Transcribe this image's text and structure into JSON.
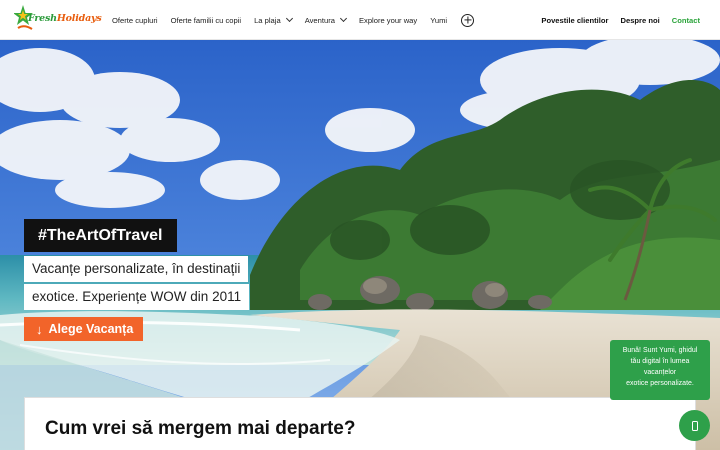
{
  "brand": {
    "logo_part1": "Fresh",
    "logo_part2": "Holidays",
    "green": "#2a9a3a",
    "orange": "#e85d0e"
  },
  "nav": {
    "items": [
      {
        "label": "Oferte cupluri",
        "dropdown": false
      },
      {
        "label": "Oferte familii cu copii",
        "dropdown": false
      },
      {
        "label": "La plaja",
        "dropdown": true
      },
      {
        "label": "Aventura",
        "dropdown": true
      },
      {
        "label": "Explore your way",
        "dropdown": false
      },
      {
        "label": "Yumi",
        "dropdown": false
      }
    ],
    "more_icon": "plus-circle-icon",
    "right": {
      "stories": "Povestile clientilor",
      "about": "Despre noi",
      "contact": "Contact"
    }
  },
  "hero": {
    "hashtag": "#TheArtOfTravel",
    "subtitle_line1": "Vacanțe personalizate, în destinații",
    "subtitle_line2": "exotice. Experiențe WOW din 2011",
    "cta_label": "Alege Vacanța",
    "cta_icon": "arrow-down-icon",
    "cta_color": "#f2642a"
  },
  "section": {
    "title": "Cum vrei să mergem mai departe?"
  },
  "chat": {
    "message_line1": "Bună! Sunt Yumi, ghidul",
    "message_line2": "tău digital în lumea",
    "message_line3": "vacanțelor",
    "message_line4": "exotice personalizate.",
    "button_icon": "phone-icon",
    "color": "#2ea04a"
  }
}
